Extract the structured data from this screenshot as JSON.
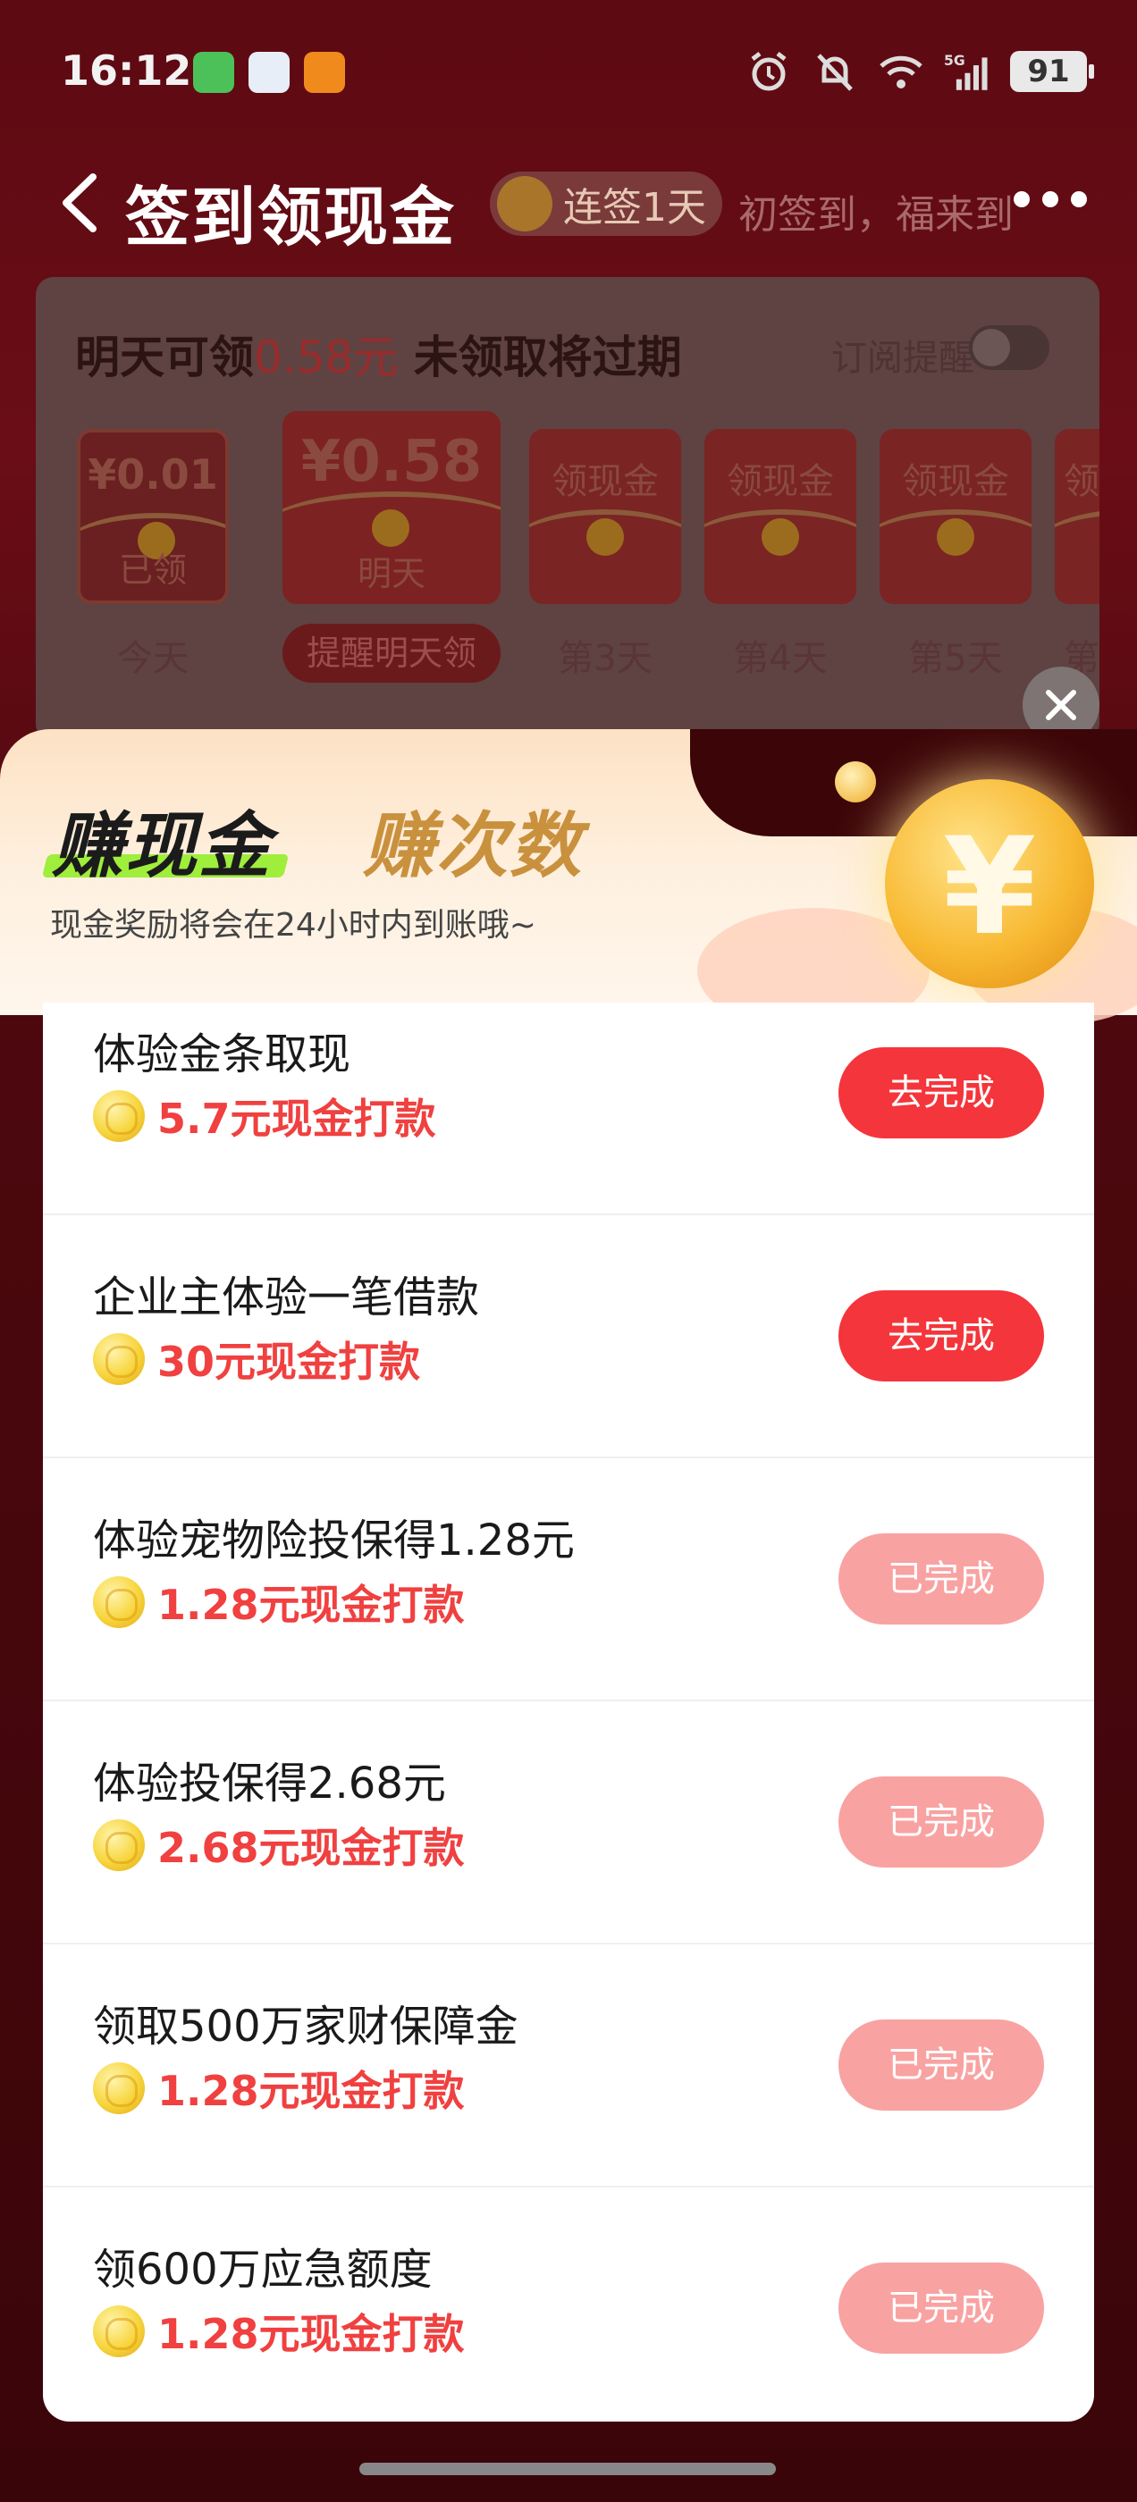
{
  "status_bar": {
    "time": "16:12",
    "battery": "91",
    "network": "5G"
  },
  "nav": {
    "title": "签到领现金",
    "streak_badge": "连签1天",
    "subtitle": "初签到，福来到"
  },
  "sign_in": {
    "headline_prefix": "明天可领",
    "headline_amount": "0.58元",
    "headline_suffix": "未领取将过期",
    "subscribe_label": "订阅提醒",
    "days": [
      {
        "top": "¥0.01",
        "bottom": "已领",
        "label": "今天"
      },
      {
        "top": "¥0.58",
        "bottom": "明天",
        "label": "提醒明天领"
      },
      {
        "top": "领现金",
        "bottom": "",
        "label": "第3天"
      },
      {
        "top": "领现金",
        "bottom": "",
        "label": "第4天"
      },
      {
        "top": "领现金",
        "bottom": "",
        "label": "第5天"
      },
      {
        "top": "领",
        "bottom": "",
        "label": "第"
      }
    ]
  },
  "modal": {
    "tabs": [
      {
        "label": "赚现金",
        "active": true
      },
      {
        "label": "赚次数",
        "active": false
      }
    ],
    "note": "现金奖励将会在24小时内到账哦~",
    "coin_symbol": "¥",
    "tasks": [
      {
        "title": "体验金条取现",
        "reward": "5.7元现金打款",
        "button": "去完成",
        "status": "todo"
      },
      {
        "title": "企业主体验一笔借款",
        "reward": "30元现金打款",
        "button": "去完成",
        "status": "todo"
      },
      {
        "title": "体验宠物险投保得1.28元",
        "reward": "1.28元现金打款",
        "button": "已完成",
        "status": "done"
      },
      {
        "title": "体验投保得2.68元",
        "reward": "2.68元现金打款",
        "button": "已完成",
        "status": "done"
      },
      {
        "title": "领取500万家财保障金",
        "reward": "1.28元现金打款",
        "button": "已完成",
        "status": "done"
      },
      {
        "title": "领600万应急额度",
        "reward": "1.28元现金打款",
        "button": "已完成",
        "status": "done"
      }
    ]
  },
  "colors": {
    "accent_red": "#f4353b",
    "done_pink": "#f9a2a2",
    "reward_red": "#f04040",
    "tab_inactive_gold": "#c9913e",
    "tab_underline_green": "#9fee3c"
  }
}
